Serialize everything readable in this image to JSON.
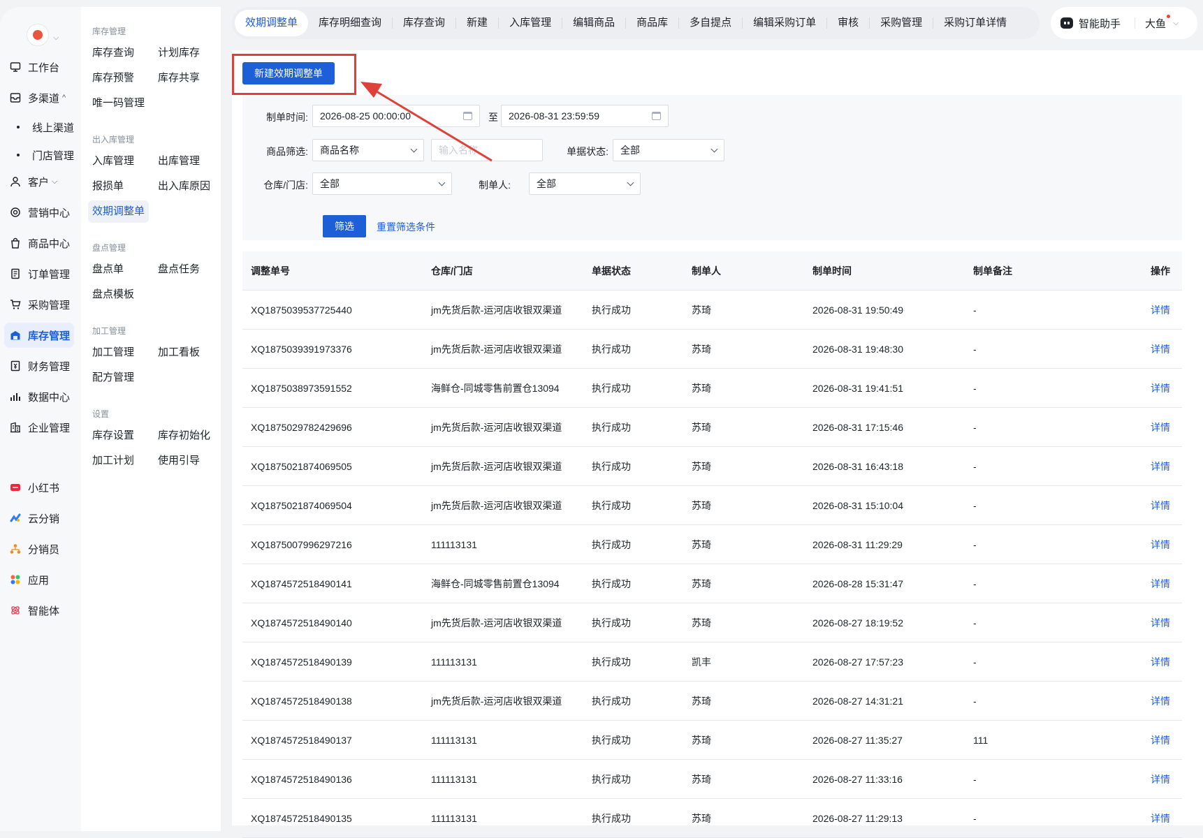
{
  "rail": {
    "items": [
      {
        "label": "工作台",
        "icon": "workbench-icon"
      },
      {
        "label": "多渠道",
        "icon": "channels-icon"
      },
      {
        "label": "线上渠道"
      },
      {
        "label": "门店管理"
      },
      {
        "label": "客户",
        "icon": "customer-icon"
      },
      {
        "label": "营销中心",
        "icon": "marketing-icon"
      },
      {
        "label": "商品中心",
        "icon": "goods-icon"
      },
      {
        "label": "订单管理",
        "icon": "order-icon"
      },
      {
        "label": "采购管理",
        "icon": "cart-icon"
      },
      {
        "label": "库存管理",
        "icon": "warehouse-icon"
      },
      {
        "label": "财务管理",
        "icon": "finance-icon"
      },
      {
        "label": "数据中心",
        "icon": "data-icon"
      },
      {
        "label": "企业管理",
        "icon": "enterprise-icon"
      },
      {
        "label": "小红书",
        "icon": "xiaohongshu-icon"
      },
      {
        "label": "云分销",
        "icon": "cloud-distribution-icon"
      },
      {
        "label": "分销员",
        "icon": "distributor-icon"
      },
      {
        "label": "应用",
        "icon": "apps-icon"
      },
      {
        "label": "智能体",
        "icon": "agent-icon"
      }
    ],
    "caret_up": "^",
    "caret_down": "⌵"
  },
  "submenu": {
    "groups": [
      {
        "title": "库存管理",
        "items": [
          "库存查询",
          "计划库存",
          "库存预警",
          "库存共享",
          "唯一码管理"
        ]
      },
      {
        "title": "出入库管理",
        "items": [
          "入库管理",
          "出库管理",
          "报损单",
          "出入库原因",
          "效期调整单"
        ]
      },
      {
        "title": "盘点管理",
        "items": [
          "盘点单",
          "盘点任务",
          "盘点模板"
        ]
      },
      {
        "title": "加工管理",
        "items": [
          "加工管理",
          "加工看板",
          "配方管理"
        ]
      },
      {
        "title": "设置",
        "items": [
          "库存设置",
          "库存初始化",
          "加工计划",
          "使用引导"
        ]
      }
    ]
  },
  "tabs": [
    "效期调整单",
    "库存明细查询",
    "库存查询",
    "新建",
    "入库管理",
    "编辑商品",
    "商品库",
    "多自提点",
    "编辑采购订单",
    "审核",
    "采购管理",
    "采购订单详情"
  ],
  "assistant": {
    "label": "智能助手",
    "user": "大鱼"
  },
  "main": {
    "new_button": "新建效期调整单",
    "filters": {
      "time_label": "制单时间:",
      "start": "2026-08-25 00:00:00",
      "to": "至",
      "end": "2026-08-31 23:59:59",
      "goods_label": "商品筛选:",
      "goods_type": "商品名称",
      "goods_placeholder": "输入名称",
      "status_label": "单据状态:",
      "status": "全部",
      "store_label": "仓库/门店:",
      "store": "全部",
      "maker_label": "制单人:",
      "maker": "全部",
      "filter_button": "筛选",
      "reset": "重置筛选条件"
    },
    "table": {
      "columns": [
        "调整单号",
        "仓库/门店",
        "单据状态",
        "制单人",
        "制单时间",
        "制单备注",
        "操作"
      ],
      "rows": [
        [
          "XQ1875039537725440",
          "jm先货后款-运河店收银双渠道",
          "执行成功",
          "苏琦",
          "2026-08-31 19:50:49",
          "-",
          "详情"
        ],
        [
          "XQ1875039391973376",
          "jm先货后款-运河店收银双渠道",
          "执行成功",
          "苏琦",
          "2026-08-31 19:48:30",
          "-",
          "详情"
        ],
        [
          "XQ1875038973591552",
          "海鲜仓-同城零售前置仓13094",
          "执行成功",
          "苏琦",
          "2026-08-31 19:41:51",
          "-",
          "详情"
        ],
        [
          "XQ1875029782429696",
          "jm先货后款-运河店收银双渠道",
          "执行成功",
          "苏琦",
          "2026-08-31 17:15:46",
          "-",
          "详情"
        ],
        [
          "XQ1875021874069505",
          "jm先货后款-运河店收银双渠道",
          "执行成功",
          "苏琦",
          "2026-08-31 16:43:18",
          "-",
          "详情"
        ],
        [
          "XQ1875021874069504",
          "jm先货后款-运河店收银双渠道",
          "执行成功",
          "苏琦",
          "2026-08-31 15:10:04",
          "-",
          "详情"
        ],
        [
          "XQ1875007996297216",
          "111113131",
          "执行成功",
          "苏琦",
          "2026-08-31 11:29:29",
          "-",
          "详情"
        ],
        [
          "XQ1874572518490141",
          "海鲜仓-同城零售前置仓13094",
          "执行成功",
          "苏琦",
          "2026-08-28 15:31:47",
          "-",
          "详情"
        ],
        [
          "XQ1874572518490140",
          "jm先货后款-运河店收银双渠道",
          "执行成功",
          "苏琦",
          "2026-08-27 18:19:52",
          "-",
          "详情"
        ],
        [
          "XQ1874572518490139",
          "111113131",
          "执行成功",
          "凯丰",
          "2026-08-27 17:57:23",
          "-",
          "详情"
        ],
        [
          "XQ1874572518490138",
          "jm先货后款-运河店收银双渠道",
          "执行成功",
          "苏琦",
          "2026-08-27 14:31:21",
          "-",
          "详情"
        ],
        [
          "XQ1874572518490137",
          "111113131",
          "执行成功",
          "苏琦",
          "2026-08-27 11:35:27",
          "111",
          "详情"
        ],
        [
          "XQ1874572518490136",
          "111113131",
          "执行成功",
          "苏琦",
          "2026-08-27 11:33:16",
          "-",
          "详情"
        ],
        [
          "XQ1874572518490135",
          "111113131",
          "执行成功",
          "苏琦",
          "2026-08-27 11:29:13",
          "-",
          "详情"
        ]
      ]
    }
  },
  "colors": {
    "accent": "#1d5fd6",
    "annotation": "#e0403a"
  }
}
